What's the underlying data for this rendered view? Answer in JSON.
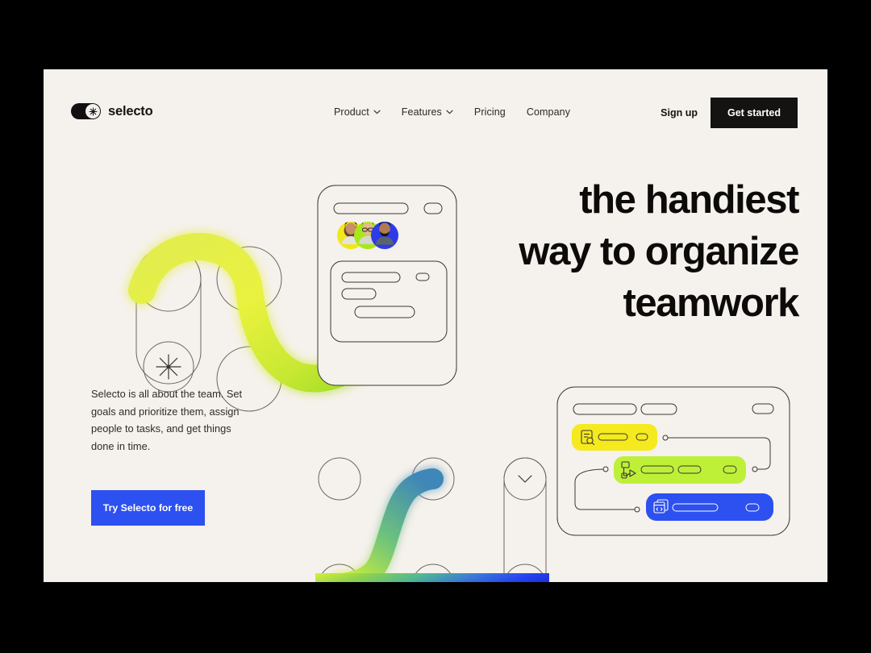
{
  "theme": {
    "frame_color": "#000000",
    "page_bg": "#F5F1EC",
    "ink": "#141312",
    "accent_blue": "#2D50F0",
    "accent_yellow": "#F5EA1E",
    "accent_lime": "#BEF038",
    "avatar_yellow": "#F0E818",
    "avatar_green": "#A8E81A",
    "avatar_blue": "#2D3BE8"
  },
  "brand": {
    "name": "selecto",
    "logo_icon": "toggle-asterisk-icon"
  },
  "nav": {
    "links": [
      {
        "label": "Product",
        "has_dropdown": true
      },
      {
        "label": "Features",
        "has_dropdown": true
      },
      {
        "label": "Pricing",
        "has_dropdown": false
      },
      {
        "label": "Company",
        "has_dropdown": false
      }
    ],
    "signup_label": "Sign up",
    "get_started_label": "Get started"
  },
  "hero": {
    "headline_lines": [
      "the handiest",
      "way to organize",
      "teamwork"
    ],
    "body": "Selecto is all about the team. Set goals and prioritize them, assign people to tasks, and get things done in time.",
    "cta_label": "Try Selecto for free"
  },
  "illustrations": {
    "ribbon_top": {
      "name": "yellow-green-ribbon",
      "gradient_from": "#E8F03A",
      "gradient_to": "#9BDD22"
    },
    "ribbon_bottom": {
      "name": "green-blue-gradient-ribbon",
      "gradient_stops": [
        "#D8F03A",
        "#7FD05A",
        "#3FA8A0",
        "#2D50F0",
        "#1E3CE8"
      ],
      "chevron_icon": "chevron-down-icon"
    },
    "hero_card": {
      "name": "team-card",
      "avatars": [
        {
          "bg": "#F0E818",
          "name": "avatar-1"
        },
        {
          "bg": "#A8E81A",
          "name": "avatar-2"
        },
        {
          "bg": "#2D3BE8",
          "name": "avatar-3"
        }
      ]
    },
    "tasks_card": {
      "name": "workflow-card",
      "rows": [
        {
          "color": "#F5EA1E",
          "icon": "document-search-icon",
          "text_color": "#3A3733",
          "bars": 1
        },
        {
          "color": "#BEF038",
          "icon": "flowchart-node-icon",
          "text_color": "#3A3733",
          "bars": 2
        },
        {
          "color": "#2D50F0",
          "icon": "code-window-icon",
          "text_color": "#FFFFFF",
          "bars": 1
        }
      ]
    }
  }
}
